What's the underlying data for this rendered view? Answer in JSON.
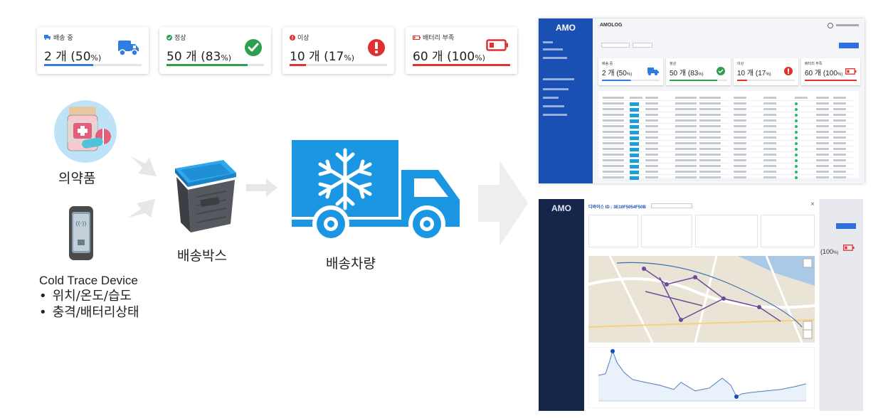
{
  "cards": [
    {
      "label": "배송 중",
      "value": "2 개 (50",
      "unit": "%)",
      "progress": 0.5,
      "color": "#2f7de1",
      "icon": "truck-icon"
    },
    {
      "label": "정상",
      "value": "50 개 (83",
      "unit": "%)",
      "progress": 0.83,
      "color": "#2e9e4f",
      "icon": "check-circle-icon"
    },
    {
      "label": "이상",
      "value": "10 개 (17",
      "unit": "%)",
      "progress": 0.17,
      "color": "#e03131",
      "icon": "alert-circle-icon"
    },
    {
      "label": "배터리 부족",
      "value": "60 개 (100",
      "unit": "%)",
      "progress": 1.0,
      "color": "#e03131",
      "icon": "battery-low-icon"
    }
  ],
  "flow": {
    "medicine": "의약품",
    "box": "배송박스",
    "vehicle": "배송차량",
    "device_title": "Cold Trace Device",
    "device_features": [
      "위치/온도/습도",
      "충격/배터리상태"
    ]
  },
  "screenshot1": {
    "logo": "AMO",
    "title": "AMOLOG",
    "cards": [
      {
        "label": "배송 중",
        "value": "2 개 (50",
        "unit": "%)"
      },
      {
        "label": "정상",
        "value": "50 개 (83",
        "unit": "%)"
      },
      {
        "label": "이상",
        "value": "10 개 (17",
        "unit": "%)"
      },
      {
        "label": "배터리 부족",
        "value": "60 개 (100",
        "unit": "%)"
      }
    ]
  },
  "screenshot2": {
    "logo": "AMO",
    "header": "디바이스 ID : 3E10F5054F50B",
    "close": "×",
    "bg_value": "(100",
    "bg_unit": "%)"
  }
}
